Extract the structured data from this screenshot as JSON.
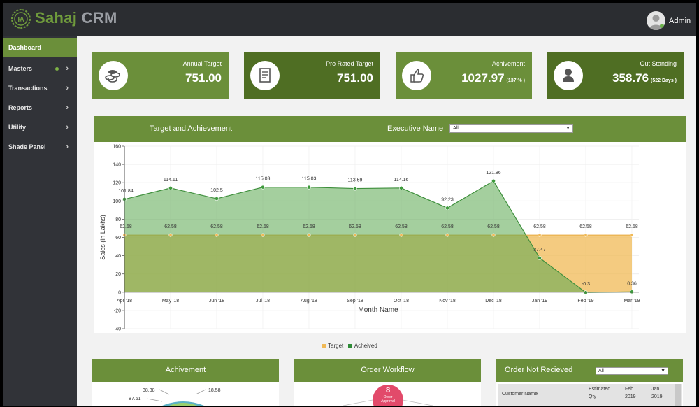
{
  "app": {
    "brand_main": "Sahaj",
    "brand_sub": "CRM",
    "user": "Admin"
  },
  "colors": {
    "accent": "#6b8f3a",
    "accent_dark": "#4f6e23",
    "target": "#f0b956",
    "achieved": "#4a9a48"
  },
  "sidebar": {
    "items": [
      {
        "label": "Dashboard",
        "active": true
      },
      {
        "label": "Masters"
      },
      {
        "label": "Transactions"
      },
      {
        "label": "Reports"
      },
      {
        "label": "Utility"
      },
      {
        "label": "Shade Panel"
      }
    ]
  },
  "kpis": [
    {
      "label": "Annual Target",
      "value": "751.00",
      "icon": "coins-icon"
    },
    {
      "label": "Pro Rated Target",
      "value": "751.00",
      "icon": "document-icon"
    },
    {
      "label": "Achivement",
      "value": "1027.97",
      "note": "(137 % )",
      "icon": "thumbs-up-icon"
    },
    {
      "label": "Out Standing",
      "value": "358.76",
      "note": "(522 Days )",
      "icon": "user-icon"
    }
  ],
  "chart_panel": {
    "title": "Target and Achievement",
    "filter_label": "Executive Name",
    "filter_value": "All"
  },
  "chart_data": {
    "type": "area",
    "xlabel": "Month Name",
    "ylabel": "Sales (in Lakhs)",
    "ylim": [
      -40,
      160
    ],
    "yticks": [
      "-40",
      "-20",
      "0",
      "20",
      "40",
      "60",
      "80",
      "100",
      "120",
      "140",
      "160"
    ],
    "categories": [
      "Apr '18",
      "May '18",
      "Jun '18",
      "Jul '18",
      "Aug '18",
      "Sep '18",
      "Oct '18",
      "Nov '18",
      "Dec '18",
      "Jan '19",
      "Feb '19",
      "Mar '19"
    ],
    "series": [
      {
        "name": "Target",
        "color": "#f0b956",
        "values": [
          62.58,
          62.58,
          62.58,
          62.58,
          62.58,
          62.58,
          62.58,
          62.58,
          62.58,
          62.58,
          62.58,
          62.58
        ],
        "labels": [
          "62.58",
          "62.58",
          "62.58",
          "62.58",
          "62.58",
          "62.58",
          "62.58",
          "62.58",
          "62.58",
          "62.58",
          "62.58",
          "62.58"
        ]
      },
      {
        "name": "Acheived",
        "color": "#4a9a48",
        "values": [
          101.84,
          114.11,
          102.5,
          115.03,
          115.03,
          113.59,
          114.16,
          92.23,
          121.86,
          37.47,
          -0.3,
          0.36
        ],
        "labels": [
          "101.84",
          "114.11",
          "102.5",
          "115.03",
          "115.03",
          "113.59",
          "114.16",
          "92.23",
          "121.86",
          "37.47",
          "-0.3",
          "0.36"
        ]
      }
    ],
    "grid": true,
    "legend": "bottom-center"
  },
  "legend": {
    "target": "Target",
    "achieved": "Acheived"
  },
  "panels": {
    "achievement": {
      "title": "Achivement",
      "labels": [
        "38.38",
        "18.58",
        "87.61"
      ]
    },
    "workflow": {
      "title": "Order Workflow",
      "count": "8",
      "line1": "Order",
      "line2": "Approval"
    },
    "not_received": {
      "title": "Order Not Recieved",
      "filter_value": "All",
      "headers": [
        "Customer Name",
        "Estimated",
        "Qty",
        "Feb",
        "2019",
        "Jan",
        "2019"
      ]
    }
  }
}
